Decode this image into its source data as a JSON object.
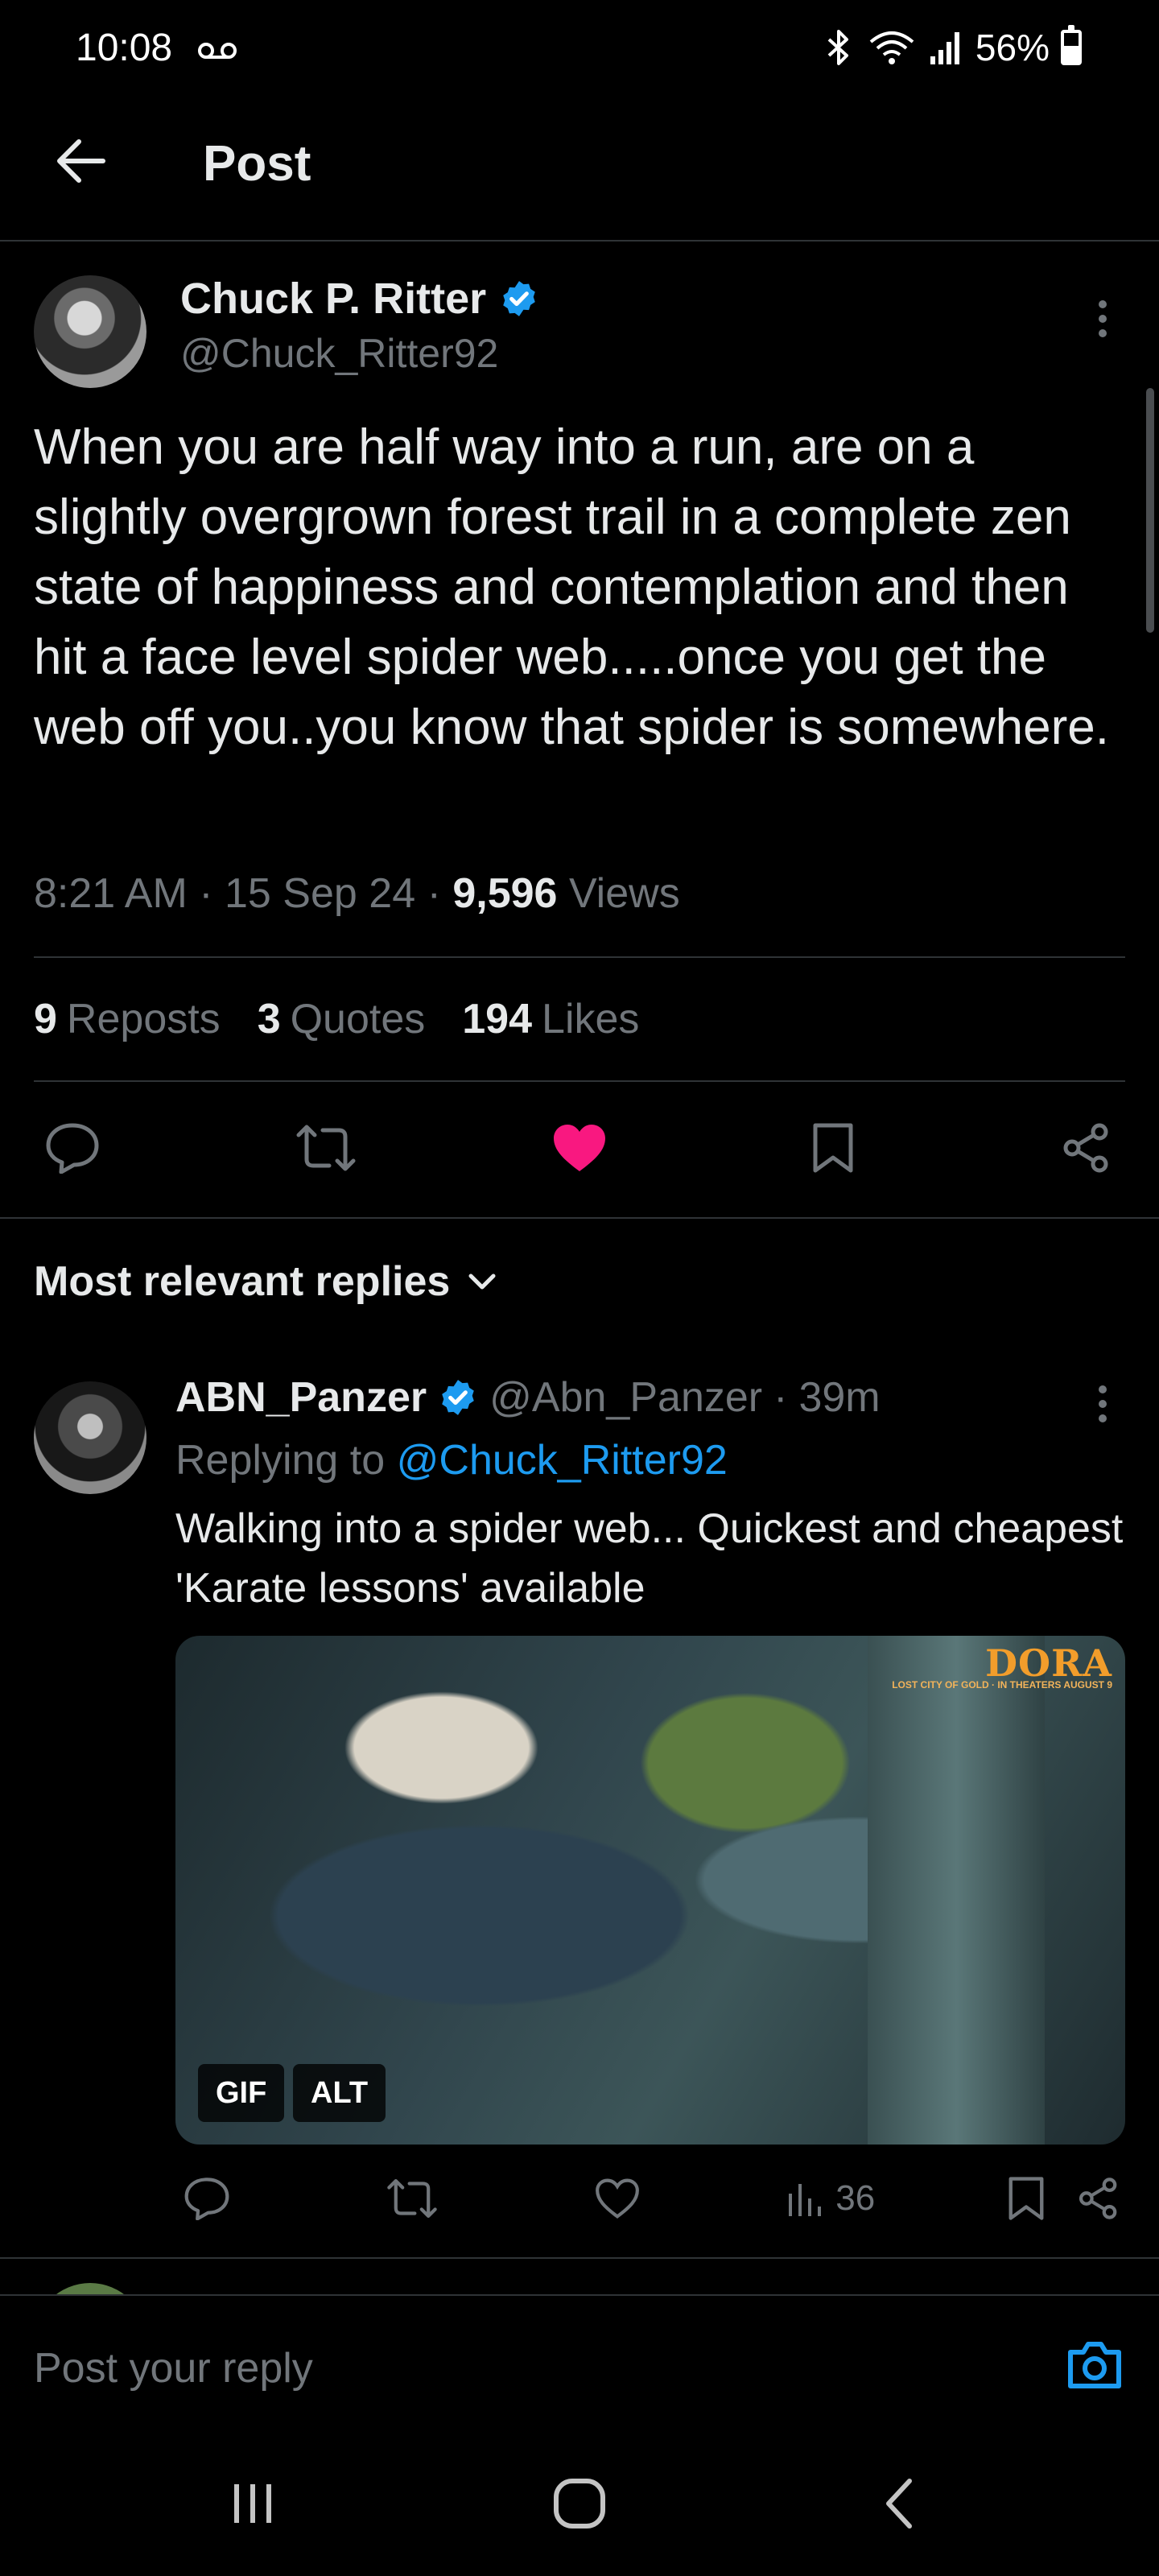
{
  "status_bar": {
    "time": "10:08",
    "battery_text": "56%",
    "battery_level": 0.56
  },
  "header": {
    "title": "Post"
  },
  "post": {
    "author_name": "Chuck P. Ritter",
    "author_handle": "@Chuck_Ritter92",
    "text": "When you are half way into a run, are on a slightly overgrown forest trail in a complete zen state of happiness and contemplation and then hit a face level spider web.....once you get the web off you..you know that spider is somewhere.",
    "time": "8:21 AM",
    "date": "15 Sep 24",
    "views_count": "9,596",
    "views_label": "Views",
    "reposts_count": "9",
    "reposts_label": "Reposts",
    "quotes_count": "3",
    "quotes_label": "Quotes",
    "likes_count": "194",
    "likes_label": "Likes",
    "liked": true,
    "like_color": "#f91880"
  },
  "replies": {
    "sort_label": "Most relevant replies",
    "items": [
      {
        "author_name": "ABN_Panzer",
        "author_handle": "@Abn_Panzer",
        "age": "39m",
        "replying_prefix": "Replying to",
        "replying_to": "@Chuck_Ritter92",
        "text": "Walking into a spider web... Quickest and cheapest 'Karate lessons' available",
        "media_watermark": "DORA",
        "media_watermark_sub": "LOST CITY OF GOLD · IN THEATERS AUGUST 9",
        "gif_badge": "GIF",
        "alt_badge": "ALT",
        "views": "36"
      }
    ]
  },
  "composer": {
    "placeholder": "Post your reply"
  },
  "colors": {
    "background": "#000000",
    "text": "#e7e9ea",
    "secondary": "#71767b",
    "link": "#1d9bf0",
    "verified": "#1d9bf0",
    "divider": "#2f3336"
  }
}
